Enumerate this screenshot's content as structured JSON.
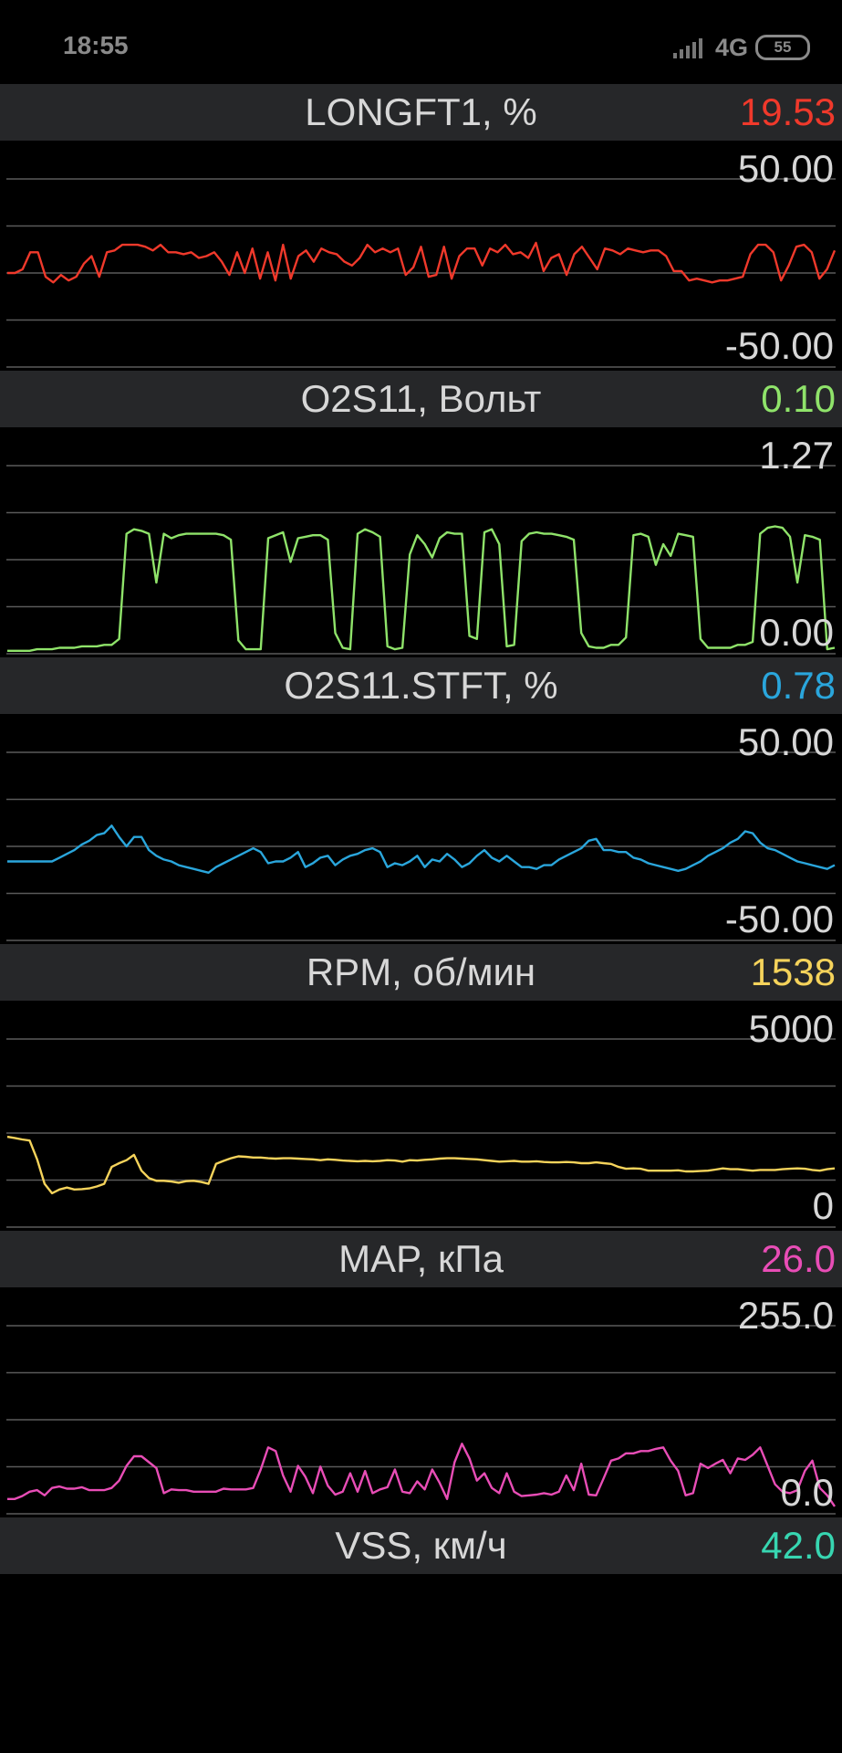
{
  "status_bar": {
    "time": "18:55",
    "network": "4G",
    "battery": "55",
    "icons": [
      "signal-icon",
      "battery-icon"
    ]
  },
  "chart_data": [
    {
      "type": "line",
      "title": "LONGFT1, %",
      "current_value": "19.53",
      "color": "#f0392b",
      "ymax_label": "50.00",
      "ymin_label": "-50.00",
      "ylim": [
        -50,
        50
      ],
      "grid": true,
      "values": [
        0,
        0,
        2,
        11,
        11,
        -2,
        -5,
        -1,
        -4,
        -2,
        5,
        9,
        -2,
        11,
        12,
        15,
        15,
        15,
        14,
        12,
        15,
        11,
        11,
        10,
        11,
        8,
        9,
        11,
        6,
        -1,
        11,
        0,
        13,
        -3,
        11,
        -4,
        15,
        -3,
        9,
        12,
        6,
        13,
        11,
        10,
        6,
        4,
        8,
        15,
        11,
        13,
        11,
        13,
        -1,
        3,
        14,
        -2,
        -1,
        14,
        -3,
        9,
        13,
        13,
        4,
        13,
        11,
        15,
        10,
        11,
        8,
        16,
        1,
        8,
        10,
        -1,
        10,
        14,
        8,
        2,
        13,
        12,
        10,
        13,
        12,
        11,
        12,
        12,
        9,
        1,
        1,
        -4,
        -3,
        -4,
        -5,
        -4,
        -4,
        -3,
        -2,
        10,
        15,
        15,
        11,
        -4,
        4,
        14,
        15,
        11,
        -3,
        2,
        12
      ]
    },
    {
      "type": "line",
      "title": "O2S11, Вольт",
      "current_value": "0.10",
      "color": "#8fe36a",
      "ymax_label": "1.27",
      "ymin_label": "0.00",
      "ylim": [
        0,
        1.27
      ],
      "grid": true,
      "values": [
        0.02,
        0.02,
        0.02,
        0.02,
        0.03,
        0.03,
        0.03,
        0.04,
        0.04,
        0.04,
        0.05,
        0.05,
        0.05,
        0.06,
        0.06,
        0.1,
        0.81,
        0.84,
        0.83,
        0.81,
        0.48,
        0.81,
        0.78,
        0.8,
        0.81,
        0.81,
        0.81,
        0.81,
        0.81,
        0.8,
        0.77,
        0.09,
        0.03,
        0.03,
        0.03,
        0.78,
        0.8,
        0.82,
        0.62,
        0.78,
        0.79,
        0.8,
        0.8,
        0.77,
        0.14,
        0.04,
        0.03,
        0.81,
        0.84,
        0.82,
        0.79,
        0.05,
        0.03,
        0.04,
        0.67,
        0.8,
        0.74,
        0.65,
        0.78,
        0.82,
        0.81,
        0.81,
        0.12,
        0.1,
        0.82,
        0.84,
        0.74,
        0.05,
        0.06,
        0.76,
        0.81,
        0.82,
        0.81,
        0.81,
        0.8,
        0.79,
        0.77,
        0.14,
        0.05,
        0.04,
        0.04,
        0.06,
        0.06,
        0.11,
        0.8,
        0.81,
        0.79,
        0.6,
        0.74,
        0.66,
        0.81,
        0.8,
        0.79,
        0.1,
        0.04,
        0.04,
        0.04,
        0.04,
        0.06,
        0.06,
        0.08,
        0.81,
        0.85,
        0.86,
        0.85,
        0.79,
        0.48,
        0.8,
        0.79,
        0.77,
        0.03,
        0.04
      ]
    },
    {
      "type": "line",
      "title": "O2S11.STFT, %",
      "current_value": "0.78",
      "color": "#2aa6dc",
      "ymax_label": "50.00",
      "ymin_label": "-50.00",
      "ylim": [
        -50,
        50
      ],
      "grid": true,
      "values": [
        -8,
        -8,
        -8,
        -8,
        -8,
        -8,
        -8,
        -6,
        -4,
        -2,
        1,
        3,
        6,
        7,
        11,
        5,
        0,
        5,
        5,
        -2,
        -5,
        -7,
        -8,
        -10,
        -11,
        -12,
        -13,
        -14,
        -11,
        -9,
        -7,
        -5,
        -3,
        -1,
        -3,
        -9,
        -8,
        -8,
        -6,
        -3,
        -11,
        -9,
        -6,
        -5,
        -10,
        -7,
        -5,
        -4,
        -2,
        -1,
        -3,
        -11,
        -9,
        -10,
        -8,
        -5,
        -11,
        -7,
        -8,
        -4,
        -7,
        -11,
        -9,
        -5,
        -2,
        -6,
        -8,
        -5,
        -8,
        -11,
        -11,
        -12,
        -10,
        -10,
        -7,
        -5,
        -3,
        -1,
        3,
        4,
        -2,
        -2,
        -3,
        -3,
        -6,
        -7,
        -9,
        -10,
        -11,
        -12,
        -13,
        -12,
        -10,
        -8,
        -5,
        -3,
        -1,
        2,
        4,
        8,
        7,
        2,
        -1,
        -2,
        -4,
        -6,
        -8,
        -9,
        -10,
        -11,
        -12,
        -10
      ]
    },
    {
      "type": "line",
      "title": "RPM, об/мин",
      "current_value": "1538",
      "color": "#f5d35b",
      "ymax_label": "5000",
      "ymin_label": "0",
      "ylim": [
        0,
        5000
      ],
      "grid": true,
      "values": [
        2400,
        2370,
        2330,
        2300,
        1800,
        1150,
        900,
        1000,
        1050,
        1000,
        1010,
        1030,
        1080,
        1150,
        1600,
        1700,
        1780,
        1920,
        1500,
        1300,
        1230,
        1230,
        1210,
        1180,
        1220,
        1230,
        1200,
        1150,
        1680,
        1760,
        1830,
        1880,
        1870,
        1850,
        1850,
        1830,
        1820,
        1830,
        1830,
        1820,
        1810,
        1800,
        1780,
        1800,
        1790,
        1770,
        1760,
        1750,
        1760,
        1750,
        1760,
        1780,
        1770,
        1740,
        1780,
        1770,
        1790,
        1800,
        1820,
        1830,
        1830,
        1820,
        1810,
        1800,
        1780,
        1760,
        1740,
        1750,
        1760,
        1740,
        1740,
        1750,
        1730,
        1720,
        1720,
        1730,
        1720,
        1700,
        1700,
        1720,
        1700,
        1680,
        1600,
        1550,
        1560,
        1550,
        1500,
        1500,
        1500,
        1500,
        1510,
        1480,
        1480,
        1490,
        1500,
        1530,
        1560,
        1540,
        1540,
        1520,
        1500,
        1520,
        1520,
        1520,
        1540,
        1550,
        1560,
        1550,
        1520,
        1500,
        1540,
        1560
      ]
    },
    {
      "type": "line",
      "title": "MAP, кПа",
      "current_value": "26.0",
      "color": "#e84db6",
      "ymax_label": "255.0",
      "ymin_label": "0.0",
      "ylim": [
        0,
        255
      ],
      "grid": true,
      "values": [
        20,
        20,
        24,
        30,
        32,
        25,
        35,
        37,
        34,
        34,
        36,
        32,
        32,
        32,
        35,
        45,
        65,
        78,
        78,
        70,
        62,
        28,
        33,
        32,
        32,
        30,
        30,
        30,
        30,
        34,
        33,
        33,
        33,
        35,
        60,
        90,
        85,
        52,
        30,
        65,
        50,
        28,
        64,
        38,
        26,
        30,
        55,
        30,
        58,
        28,
        33,
        36,
        60,
        30,
        28,
        44,
        33,
        60,
        42,
        20,
        70,
        95,
        75,
        45,
        55,
        35,
        28,
        55,
        30,
        24,
        25,
        26,
        28,
        26,
        30,
        52,
        32,
        68,
        26,
        25,
        48,
        72,
        75,
        82,
        82,
        85,
        85,
        88,
        90,
        72,
        58,
        25,
        28,
        68,
        62,
        68,
        73,
        55,
        75,
        73,
        80,
        90,
        65,
        40,
        30,
        28,
        32,
        58,
        72,
        35,
        25,
        10
      ]
    }
  ],
  "partial_panel": {
    "title": "VSS, км/ч",
    "current_value": "42.0",
    "color": "#37d6b1"
  }
}
